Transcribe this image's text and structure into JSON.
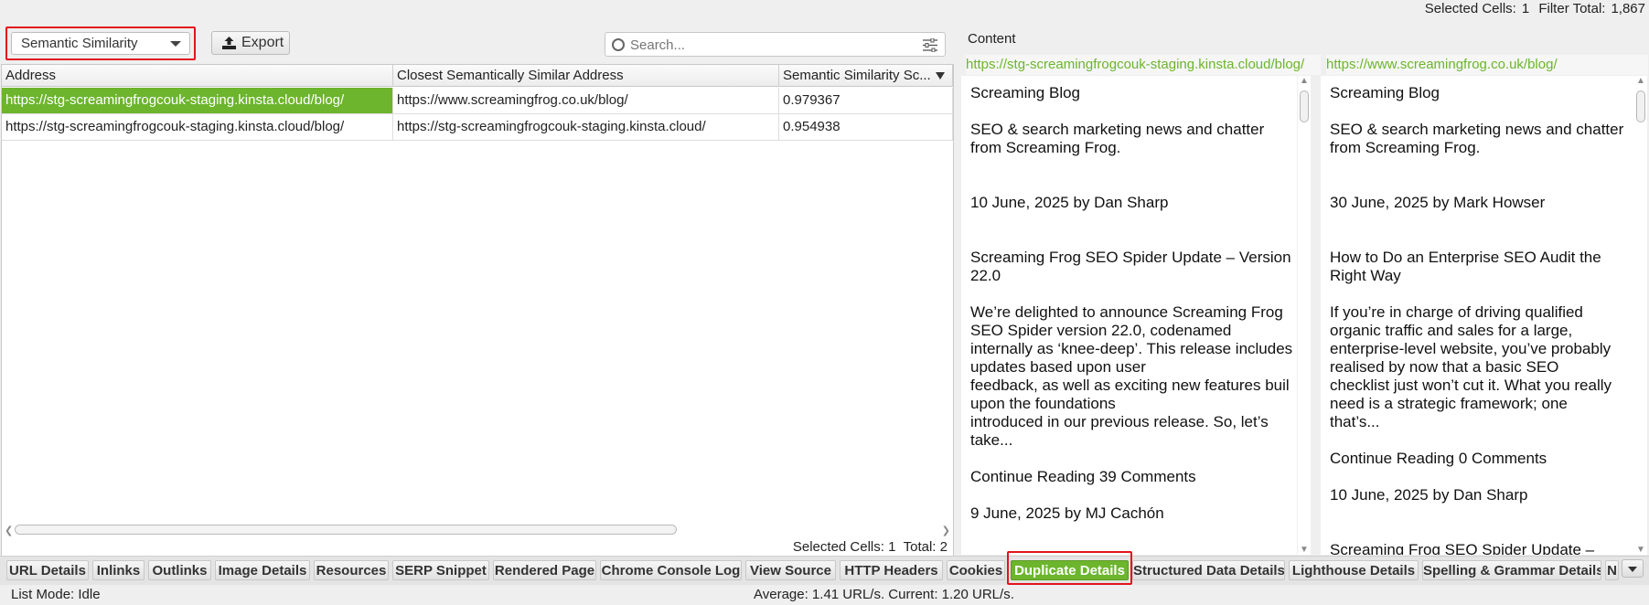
{
  "top_status": {
    "selected_cells_label": "Selected Cells:",
    "selected_cells_value": "1",
    "filter_total_label": "Filter Total:",
    "filter_total_value": "1,867"
  },
  "toolbar": {
    "filter_dropdown": "Semantic Similarity",
    "export_label": "Export",
    "search_placeholder": "Search..."
  },
  "table": {
    "columns": [
      "Address",
      "Closest Semantically Similar Address",
      "Semantic Similarity Sc..."
    ],
    "rows": [
      [
        "https://stg-screamingfrogcouk-staging.kinsta.cloud/blog/",
        "https://www.screamingfrog.co.uk/blog/",
        "0.979367"
      ],
      [
        "https://stg-screamingfrogcouk-staging.kinsta.cloud/blog/",
        "https://stg-screamingfrogcouk-staging.kinsta.cloud/",
        "0.954938"
      ]
    ],
    "status_selected_label": "Selected Cells:",
    "status_selected_value": "1",
    "status_total_label": "Total:",
    "status_total_value": "2"
  },
  "content": {
    "label": "Content",
    "left": {
      "url": "https://stg-screamingfrogcouk-staging.kinsta.cloud/blog/",
      "lines": [
        "Screaming Blog",
        "",
        "SEO & search marketing news and chatter",
        "from Screaming Frog.",
        "",
        "",
        "10 June, 2025 by Dan Sharp",
        "",
        "",
        "Screaming Frog SEO Spider Update – Version",
        "22.0",
        "",
        "We’re delighted to announce Screaming Frog",
        "SEO Spider version 22.0, codenamed",
        "internally as ‘knee-deep’. This release includes",
        "updates based upon user",
        "feedback, as well as exciting new features buil",
        "upon the foundations",
        "introduced in our previous release. So, let’s",
        "take...",
        "",
        "Continue Reading 39 Comments",
        "",
        "9 June, 2025 by MJ Cachón"
      ]
    },
    "right": {
      "url": "https://www.screamingfrog.co.uk/blog/",
      "lines": [
        "Screaming Blog",
        "",
        "SEO & search marketing news and chatter",
        "from Screaming Frog.",
        "",
        "",
        "30 June, 2025 by Mark Howser",
        "",
        "",
        "How to Do an Enterprise SEO Audit the",
        "Right Way",
        "",
        "If you’re in charge of driving qualified",
        "organic traffic and sales for a large,",
        "enterprise-level website, you’ve probably",
        "realised by now that a basic SEO",
        "checklist just won’t cut it. What you really",
        "need is a strategic framework; one",
        "that’s...",
        "",
        "Continue Reading 0 Comments",
        "",
        "10 June, 2025 by Dan Sharp",
        "",
        "",
        "Screaming Frog SEO Spider Update –"
      ]
    }
  },
  "bottom_tabs": [
    "URL Details",
    "Inlinks",
    "Outlinks",
    "Image Details",
    "Resources",
    "SERP Snippet",
    "Rendered Page",
    "Chrome Console Log",
    "View Source",
    "HTTP Headers",
    "Cookies",
    "Duplicate Details",
    "Structured Data Details",
    "Lighthouse Details",
    "Spelling & Grammar Details",
    "N"
  ],
  "active_tab": "Duplicate Details",
  "status_bar": {
    "mode": "List Mode: Idle",
    "speed": "Average: 1.41 URL/s. Current: 1.20 URL/s."
  },
  "colors": {
    "accent_green": "#6cb52d",
    "highlight_red": "#e0141e"
  }
}
